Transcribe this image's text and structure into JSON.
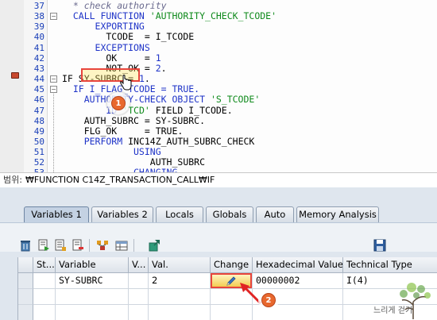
{
  "editor": {
    "lines": [
      {
        "n": "37",
        "parts": [
          {
            "t": "  * check authority",
            "c": "comment"
          }
        ]
      },
      {
        "n": "38",
        "parts": [
          {
            "t": "  CALL FUNCTION ",
            "c": "kw"
          },
          {
            "t": "'AUTHORITY_CHECK_TCODE'",
            "c": "str"
          }
        ]
      },
      {
        "n": "39",
        "parts": [
          {
            "t": "      EXPORTING",
            "c": "kw"
          }
        ]
      },
      {
        "n": "40",
        "parts": [
          {
            "t": "        TCODE  = I_TCODE",
            "c": "plain"
          }
        ]
      },
      {
        "n": "41",
        "parts": [
          {
            "t": "      EXCEPTIONS",
            "c": "kw"
          }
        ]
      },
      {
        "n": "42",
        "parts": [
          {
            "t": "        OK     = ",
            "c": "plain"
          },
          {
            "t": "1",
            "c": "num"
          }
        ]
      },
      {
        "n": "43",
        "parts": [
          {
            "t": "        NOT_OK = ",
            "c": "plain"
          },
          {
            "t": "2",
            "c": "num"
          },
          {
            "t": ".",
            "c": "plain"
          }
        ]
      },
      {
        "n": "44",
        "parts": [
          {
            "t": "IF ",
            "c": "plain"
          },
          {
            "t": "SY-SUBRC",
            "c": "plain"
          },
          {
            "t": " = ",
            "c": "plain"
          },
          {
            "t": "1",
            "c": "num"
          },
          {
            "t": ".",
            "c": "plain"
          }
        ]
      },
      {
        "n": "45",
        "parts": [
          {
            "t": "  IF I_FLAG_TCODE = TRUE.",
            "c": "kw"
          }
        ]
      },
      {
        "n": "46",
        "parts": [
          {
            "t": "    AUTHORITY-CHECK OBJECT ",
            "c": "kw"
          },
          {
            "t": "'S_TCODE'",
            "c": "str"
          }
        ]
      },
      {
        "n": "47",
        "parts": [
          {
            "t": "        ID ",
            "c": "kw"
          },
          {
            "t": "'TCD'",
            "c": "str"
          },
          {
            "t": " FIELD I_TCODE.",
            "c": "plain"
          }
        ]
      },
      {
        "n": "48",
        "parts": [
          {
            "t": "    AUTH_SUBRC = SY-SUBRC.",
            "c": "plain"
          }
        ]
      },
      {
        "n": "49",
        "parts": [
          {
            "t": "    FLG_OK     = TRUE.",
            "c": "plain"
          }
        ]
      },
      {
        "n": "50",
        "parts": [
          {
            "t": "    PERFORM ",
            "c": "kw"
          },
          {
            "t": "INC14Z_AUTH_SUBRC_CHECK",
            "c": "plain"
          }
        ]
      },
      {
        "n": "51",
        "parts": [
          {
            "t": "             USING",
            "c": "kw"
          }
        ]
      },
      {
        "n": "52",
        "parts": [
          {
            "t": "                AUTH_SUBRC",
            "c": "plain"
          }
        ]
      },
      {
        "n": "53",
        "parts": [
          {
            "t": "             CHANGING",
            "c": "kw"
          }
        ]
      }
    ]
  },
  "scope": {
    "label": "범위:",
    "value": "₩FUNCTION C14Z_TRANSACTION_CALL₩IF"
  },
  "tabs": [
    {
      "label": "Variables 1",
      "active": true
    },
    {
      "label": "Variables 2",
      "active": false
    },
    {
      "label": "Locals",
      "active": false
    },
    {
      "label": "Globals",
      "active": false
    },
    {
      "label": "Auto",
      "active": false
    },
    {
      "label": "Memory Analysis",
      "active": false
    }
  ],
  "toolbar": {
    "icons": [
      "trash-icon",
      "import-variables-icon",
      "delete-variables-icon",
      "row-icon",
      "dependency-icon",
      "table-icon",
      "save-icon"
    ]
  },
  "grid": {
    "columns": [
      "St...",
      "Variable",
      "V...",
      "Val.",
      "Change",
      "Hexadecimal Value",
      "Technical Type"
    ],
    "rows": [
      {
        "status": "",
        "variable": "SY-SUBRC",
        "v": "",
        "val": "2",
        "change": "pencil",
        "hex": "00000002",
        "type": "I(4)"
      }
    ]
  },
  "annotations": {
    "marker1": "1",
    "marker2": "2",
    "highlight_color": "#e8453c",
    "marker_color": "#e8682e"
  },
  "watermark": {
    "text": "느리게 걷기"
  }
}
